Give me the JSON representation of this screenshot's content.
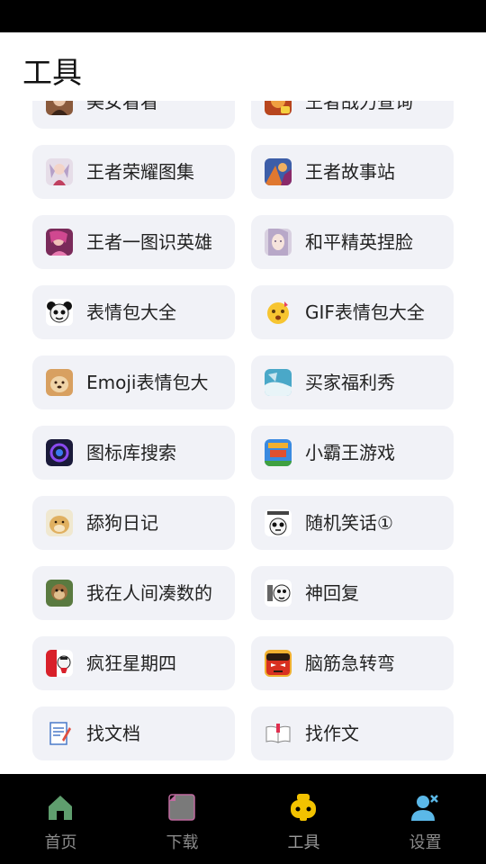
{
  "header": {
    "title": "工具"
  },
  "tools": [
    {
      "label": "美女看看",
      "icon": "beauty-photo-icon"
    },
    {
      "label": "王者战力查询",
      "icon": "hero-power-icon"
    },
    {
      "label": "王者荣耀图集",
      "icon": "hero-gallery-icon"
    },
    {
      "label": "王者故事站",
      "icon": "hero-story-icon"
    },
    {
      "label": "王者一图识英雄",
      "icon": "hero-guess-icon"
    },
    {
      "label": "和平精英捏脸",
      "icon": "face-sculpt-icon"
    },
    {
      "label": "表情包大全",
      "icon": "panda-meme-icon"
    },
    {
      "label": "GIF表情包大全",
      "icon": "gif-emoji-icon"
    },
    {
      "label": "Emoji表情包大",
      "icon": "emoji-dog-icon"
    },
    {
      "label": "买家福利秀",
      "icon": "buyer-show-icon"
    },
    {
      "label": "图标库搜索",
      "icon": "icon-search-icon"
    },
    {
      "label": "小霸王游戏",
      "icon": "retro-game-icon"
    },
    {
      "label": "舔狗日记",
      "icon": "doge-diary-icon"
    },
    {
      "label": "随机笑话①",
      "icon": "joke-panda-icon"
    },
    {
      "label": "我在人间凑数的",
      "icon": "meme-monkey-icon"
    },
    {
      "label": "神回复",
      "icon": "reply-panda-icon"
    },
    {
      "label": "疯狂星期四",
      "icon": "kfc-icon"
    },
    {
      "label": "脑筋急转弯",
      "icon": "brain-teaser-icon"
    },
    {
      "label": "找文档",
      "icon": "document-icon"
    },
    {
      "label": "找作文",
      "icon": "essay-book-icon"
    }
  ],
  "tabbar": {
    "tabs": [
      {
        "label": "首页",
        "icon": "home-icon"
      },
      {
        "label": "下载",
        "icon": "download-icon"
      },
      {
        "label": "工具",
        "icon": "tools-icon"
      },
      {
        "label": "设置",
        "icon": "settings-user-icon"
      }
    ],
    "active_index": 2
  },
  "colors": {
    "card_bg": "#f1f2f7",
    "tool_active": "#f2c200",
    "home_green": "#5f9e6e",
    "download_pink": "#c06aa0",
    "settings_blue": "#5bb8e8"
  }
}
